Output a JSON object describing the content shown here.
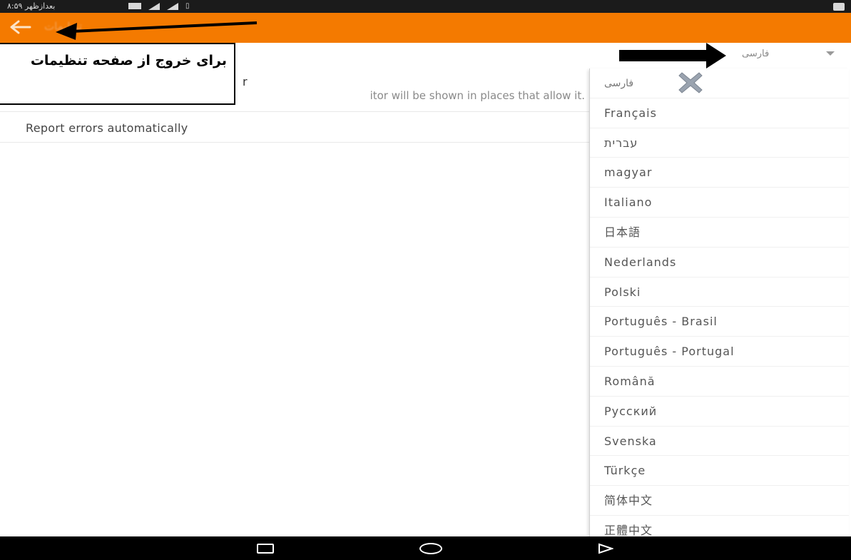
{
  "status_bar": {
    "text": "۸:۵۹ بعدازظهر"
  },
  "app_bar": {
    "title": "تنظیمات"
  },
  "settings": {
    "editor_title": "r",
    "editor_description": "itor will be shown in places that allow it.",
    "report_errors_label": "Report errors automatically"
  },
  "language": {
    "selected": "فارسی",
    "options": [
      "فارسی",
      "Français",
      "עברית",
      "magyar",
      "Italiano",
      "日本語",
      "Nederlands",
      "Polski",
      "Português - Brasil",
      "Português - Portugal",
      "Română",
      "Русский",
      "Svenska",
      "Türkçe",
      "简体中文",
      "正體中文"
    ]
  },
  "annotation": {
    "text": "برای خروج از صفحه تنظیمات"
  },
  "colors": {
    "accent": "#f47a00",
    "status_bar": "#1b1b1b",
    "nav_bar": "#000000"
  },
  "icons": {
    "back": "arrow-left-icon",
    "caret": "chevron-down-icon",
    "recents": "square-icon",
    "home": "circle-icon",
    "nav_back": "triangle-icon",
    "x_mark": "x-mark-icon"
  }
}
